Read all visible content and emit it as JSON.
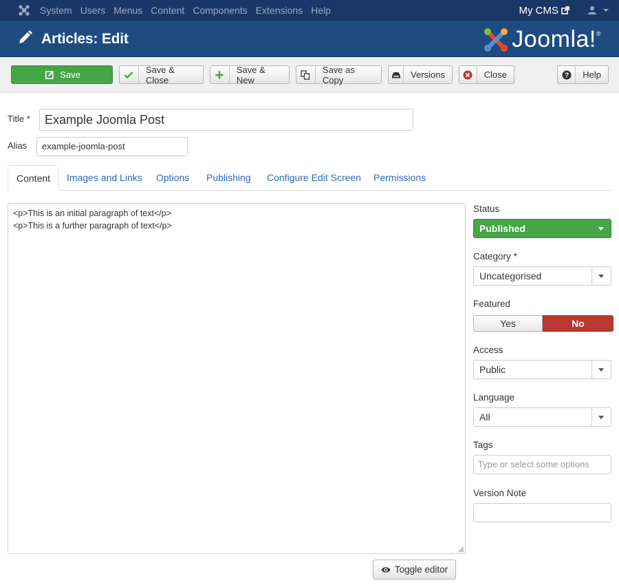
{
  "navbar": {
    "items": [
      "System",
      "Users",
      "Menus",
      "Content",
      "Components",
      "Extensions",
      "Help"
    ],
    "site_name": "My CMS"
  },
  "header": {
    "title": "Articles: Edit",
    "brand": "Joomla!"
  },
  "toolbar": {
    "save": "Save",
    "save_close": "Save & Close",
    "save_new": "Save & New",
    "save_copy": "Save as Copy",
    "versions": "Versions",
    "close": "Close",
    "help": "Help"
  },
  "form": {
    "title_label": "Title *",
    "title_value": "Example Joomla Post",
    "alias_label": "Alias",
    "alias_value": "example-joomla-post"
  },
  "tabs": [
    "Content",
    "Images and Links",
    "Options",
    "Publishing",
    "Configure Edit Screen",
    "Permissions"
  ],
  "editor": {
    "lines": [
      "<p>This is an initial paragraph of text</p>",
      "<p>This is a further paragraph of text</p>"
    ],
    "toggle_label": "Toggle editor"
  },
  "sidebar": {
    "status_label": "Status",
    "status_value": "Published",
    "category_label": "Category *",
    "category_value": "Uncategorised",
    "featured_label": "Featured",
    "featured_yes": "Yes",
    "featured_no": "No",
    "access_label": "Access",
    "access_value": "Public",
    "language_label": "Language",
    "language_value": "All",
    "tags_label": "Tags",
    "tags_placeholder": "Type or select some options",
    "version_note_label": "Version Note",
    "version_note_value": ""
  },
  "colors": {
    "navbar": "#1a3867",
    "header": "#1e4c80",
    "success": "#46a546",
    "danger": "#bd362f",
    "link": "#2a69b8"
  }
}
